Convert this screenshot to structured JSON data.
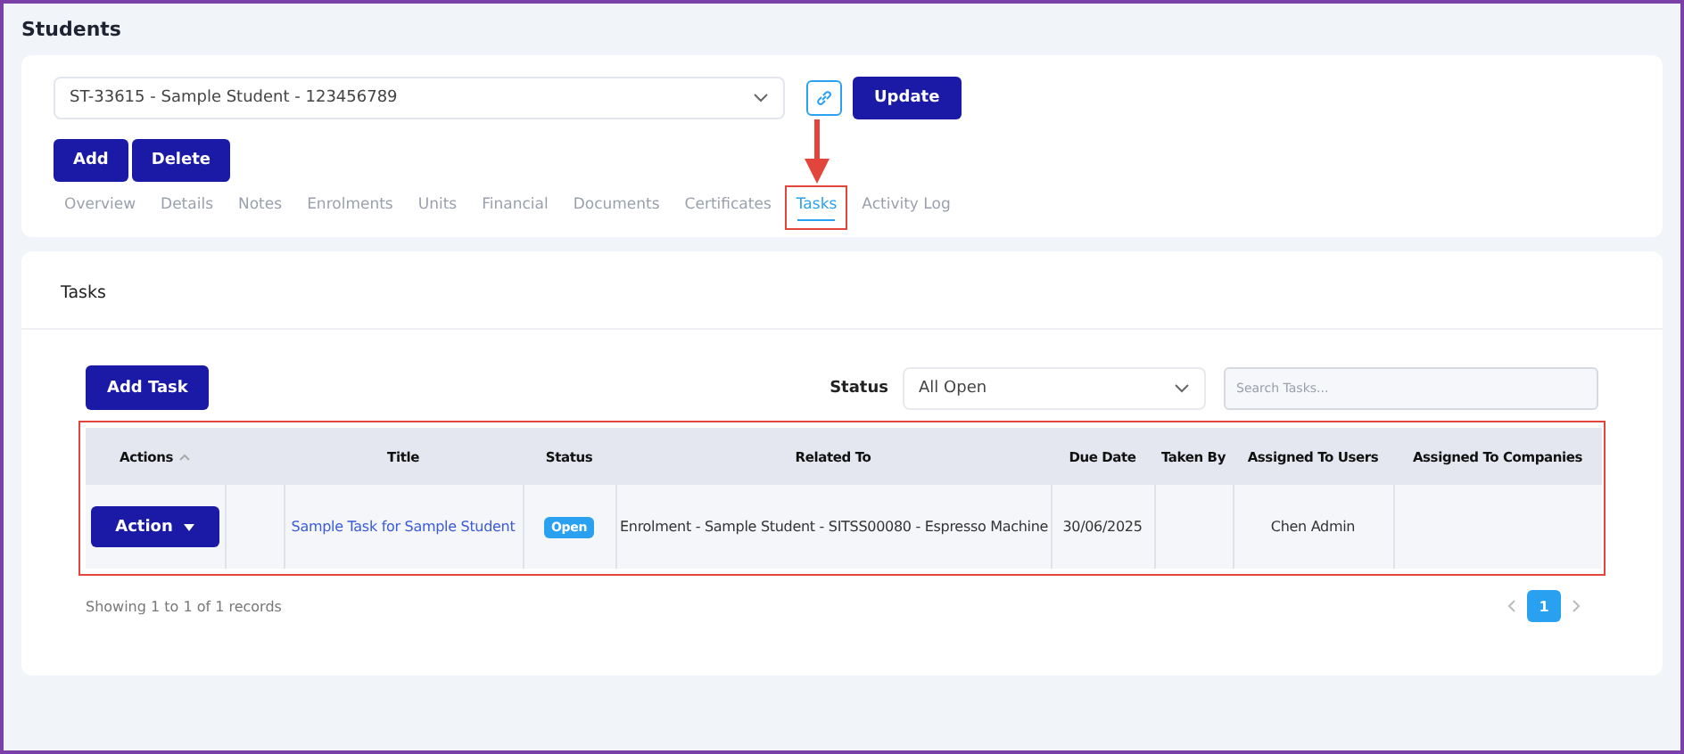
{
  "page": {
    "title": "Students"
  },
  "student_select": {
    "value": "ST-33615 - Sample Student - 123456789"
  },
  "header_buttons": [
    "Update"
  ],
  "action_buttons": [
    "Add",
    "Delete"
  ],
  "tabs": [
    {
      "label": "Overview",
      "selected": false
    },
    {
      "label": "Details",
      "selected": false
    },
    {
      "label": "Notes",
      "selected": false
    },
    {
      "label": "Enrolments",
      "selected": false
    },
    {
      "label": "Units",
      "selected": false
    },
    {
      "label": "Financial",
      "selected": false
    },
    {
      "label": "Documents",
      "selected": false
    },
    {
      "label": "Certificates",
      "selected": false
    },
    {
      "label": "Tasks",
      "selected": true
    },
    {
      "label": "Activity Log",
      "selected": false
    }
  ],
  "tasks_panel": {
    "title": "Tasks",
    "add_button": "Add Task",
    "status_label": "Status",
    "status_value": "All Open",
    "search": {
      "placeholder": "Search Tasks..."
    }
  },
  "table": {
    "columns": [
      "Actions",
      "",
      "Title",
      "Status",
      "Related To",
      "Due Date",
      "Taken By",
      "Assigned To Users",
      "Assigned To Companies"
    ],
    "rows": [
      {
        "action": "Action",
        "title": "Sample Task for Sample Student",
        "status": "Open",
        "related_to": "Enrolment - Sample Student - SITSS00080 - Espresso Machine",
        "due_date": "30/06/2025",
        "taken_by": "",
        "assigned_users": "Chen Admin",
        "assigned_companies": ""
      }
    ]
  },
  "footer": {
    "summary": "Showing 1 to 1 of 1 records",
    "pages": [
      {
        "label": "1",
        "selected": true
      }
    ]
  }
}
